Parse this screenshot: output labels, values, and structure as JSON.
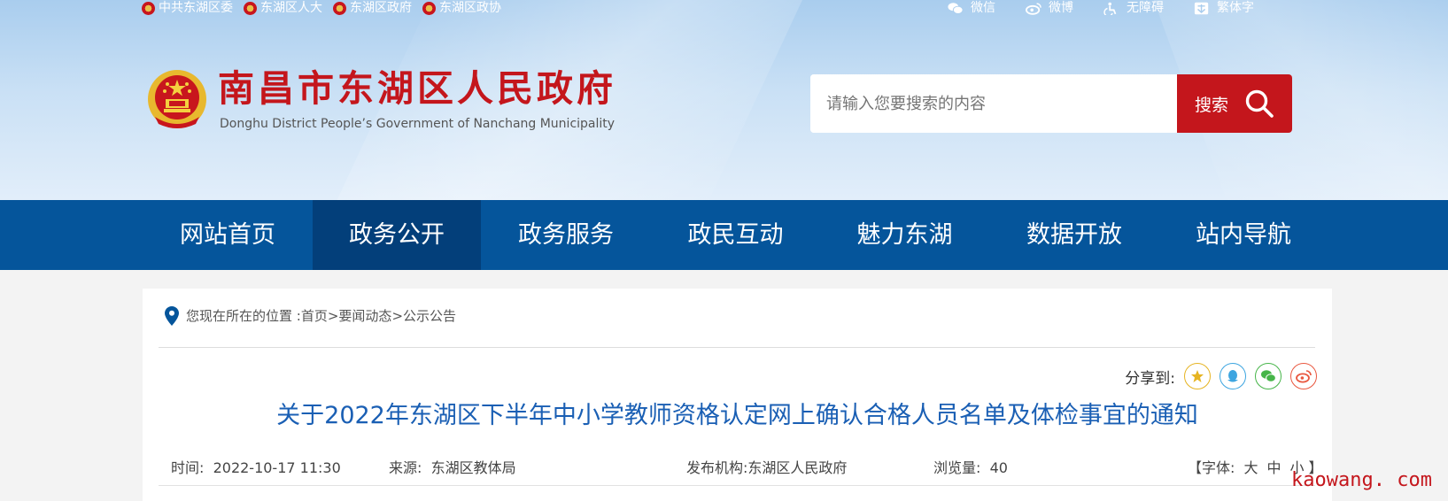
{
  "topbar": {
    "left_links": [
      "中共东湖区委",
      "东湖区人大",
      "东湖区政府",
      "东湖区政协"
    ],
    "right_links": [
      {
        "label": "微信",
        "icon": "wechat-icon"
      },
      {
        "label": "微博",
        "icon": "weibo-icon"
      },
      {
        "label": "无障碍",
        "icon": "accessibility-icon"
      },
      {
        "label": "繁体字",
        "icon": "traditional-chinese-icon"
      }
    ]
  },
  "header": {
    "title": "南昌市东湖区人民政府",
    "subtitle": "Donghu District  People’s Government of Nanchang  Municipality"
  },
  "search": {
    "placeholder": "请输入您要搜索的内容",
    "button_label": "搜索"
  },
  "nav": {
    "items": [
      "网站首页",
      "政务公开",
      "政务服务",
      "政民互动",
      "魅力东湖",
      "数据开放",
      "站内导航"
    ],
    "active_index": 1
  },
  "breadcrumb": {
    "prefix": "您现在所在的位置 : ",
    "items": [
      "首页",
      "要闻动态",
      "公示公告"
    ],
    "separator": ">"
  },
  "share": {
    "label": "分享到:",
    "targets": [
      "favorite",
      "qq",
      "wechat",
      "weibo"
    ]
  },
  "article": {
    "title": "关于2022年东湖区下半年中小学教师资格认定网上确认合格人员名单及体检事宜的通知",
    "time_label": "时间:",
    "time_value": "2022-10-17 11:30",
    "source_label": "来源:",
    "source_value": "东湖区教体局",
    "publisher_label": "发布机构:",
    "publisher_value": "东湖区人民政府",
    "views_label": "浏览量:",
    "views_value": "40",
    "font_open": "【字体:",
    "font_large": "大",
    "font_medium": "中",
    "font_small": "小",
    "font_close": "】"
  },
  "watermark": "kaowang. com",
  "colors": {
    "brand_red": "#c4161c",
    "nav_blue": "#05559b",
    "nav_active": "#033f7a",
    "title_blue": "#1a5fb4"
  }
}
